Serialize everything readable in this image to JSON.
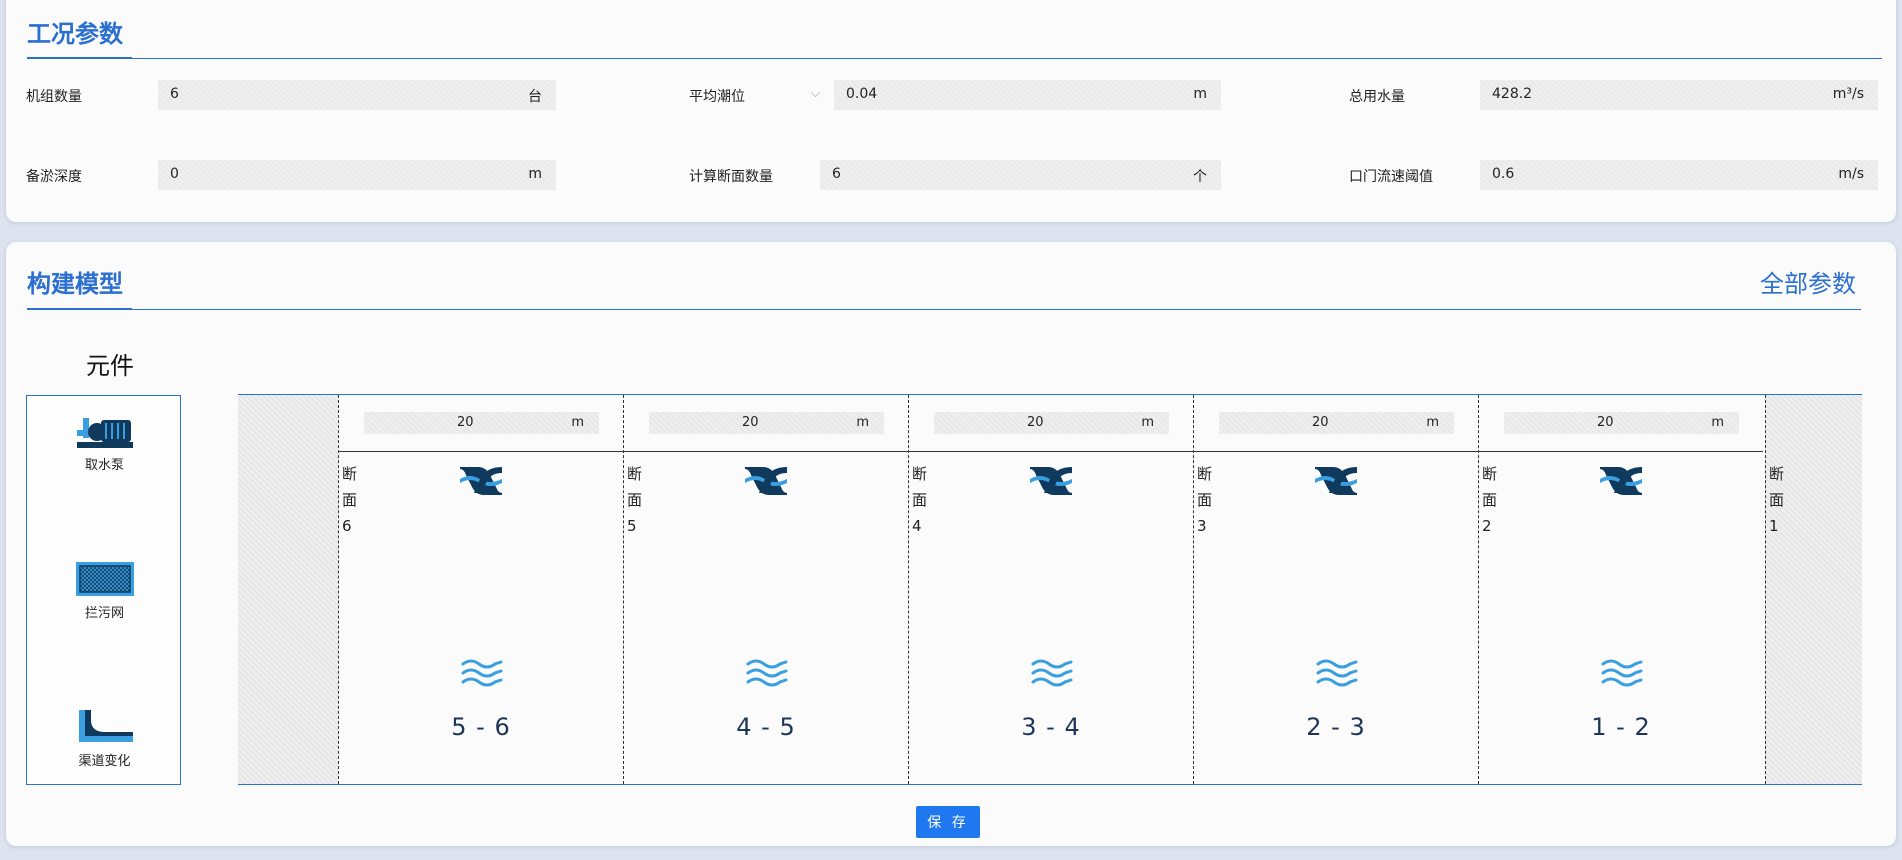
{
  "params_section": {
    "title": "工况参数",
    "rows": [
      [
        {
          "label": "机组数量",
          "value": "6",
          "unit": "台"
        },
        {
          "label": "平均潮位",
          "value": "0.04",
          "unit": "m",
          "dropdown": true
        },
        {
          "label": "总用水量",
          "value": "428.2",
          "unit": "m³/s"
        }
      ],
      [
        {
          "label": "备淤深度",
          "value": "0",
          "unit": "m"
        },
        {
          "label": "计算断面数量",
          "value": "6",
          "unit": "个"
        },
        {
          "label": "口门流速阈值",
          "value": "0.6",
          "unit": "m/s"
        }
      ]
    ]
  },
  "model_section": {
    "title": "构建模型",
    "all_params_link": "全部参数",
    "components_title": "元件",
    "components": [
      {
        "label": "取水泵",
        "icon": "pump-icon"
      },
      {
        "label": "拦污网",
        "icon": "trash-screen-icon"
      },
      {
        "label": "渠道变化",
        "icon": "channel-change-icon"
      }
    ],
    "columns": [
      {
        "length": "20",
        "unit": "m",
        "section": [
          "断",
          "面",
          "6"
        ],
        "range": "5 - 6"
      },
      {
        "length": "20",
        "unit": "m",
        "section": [
          "断",
          "面",
          "5"
        ],
        "range": "4 - 5"
      },
      {
        "length": "20",
        "unit": "m",
        "section": [
          "断",
          "面",
          "4"
        ],
        "range": "3 - 4"
      },
      {
        "length": "20",
        "unit": "m",
        "section": [
          "断",
          "面",
          "3"
        ],
        "range": "2 - 3"
      },
      {
        "length": "20",
        "unit": "m",
        "section": [
          "断",
          "面",
          "2"
        ],
        "range": "1 - 2"
      }
    ],
    "last_section": [
      "断",
      "面",
      "1"
    ],
    "save_button": "保 存"
  },
  "colors": {
    "accent": "#2b6fd0",
    "button": "#1f78f0",
    "section_icon": "#0f3a5e",
    "flow_icon": "#3a9fe0"
  }
}
